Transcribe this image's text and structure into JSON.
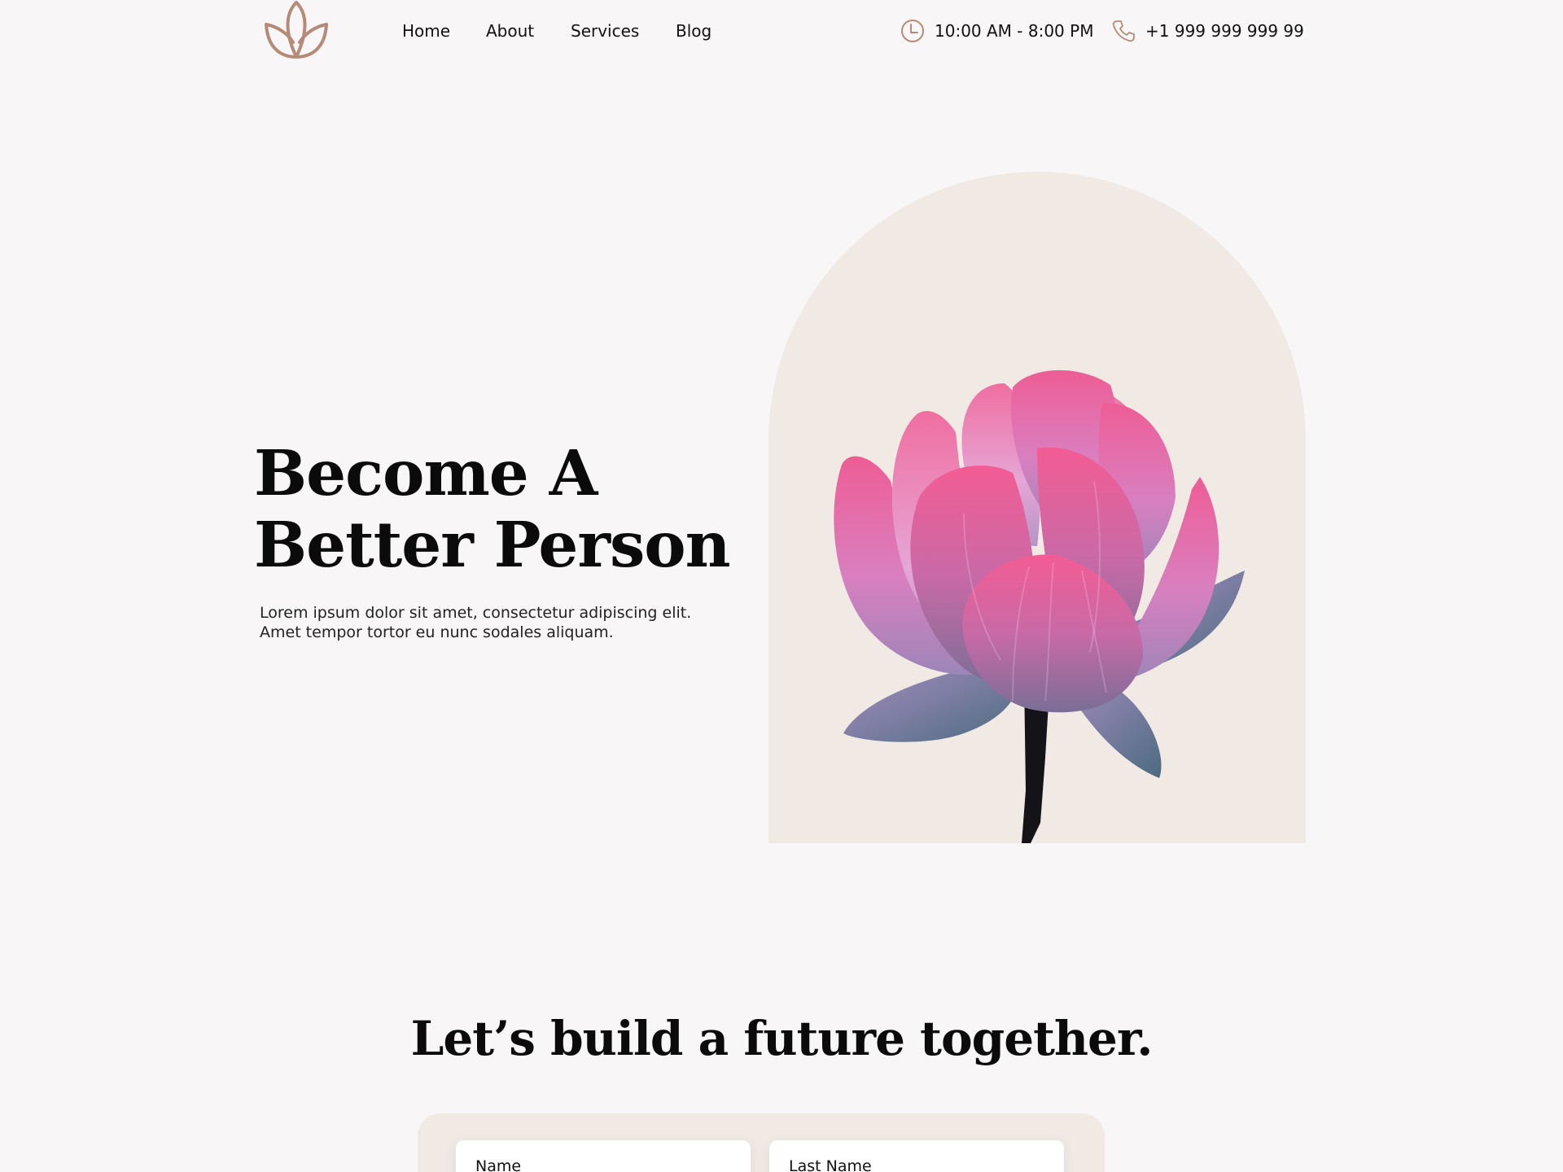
{
  "header": {
    "logo": "lotus-logo",
    "nav": [
      {
        "label": "Home"
      },
      {
        "label": "About"
      },
      {
        "label": "Services"
      },
      {
        "label": "Blog"
      }
    ],
    "hours": {
      "icon": "clock-icon",
      "text": "10:00 AM - 8:00 PM"
    },
    "phone": {
      "icon": "phone-icon",
      "text": "+1 999 999 999 99"
    }
  },
  "hero": {
    "title_line1": "Become A",
    "title_line2": "Better Person",
    "subtitle_line1": "Lorem ipsum dolor sit amet, consectetur adipiscing elit.",
    "subtitle_line2": "Amet tempor tortor eu nunc sodales aliquam.",
    "image": "lotus-flower-image"
  },
  "contact": {
    "title": "Let’s build a future together.",
    "fields": [
      {
        "label": "Name"
      },
      {
        "label": "Last Name"
      }
    ]
  },
  "colors": {
    "background": "#f8f6f6",
    "accent": "#b58a77",
    "panel": "#f0e9e4"
  }
}
